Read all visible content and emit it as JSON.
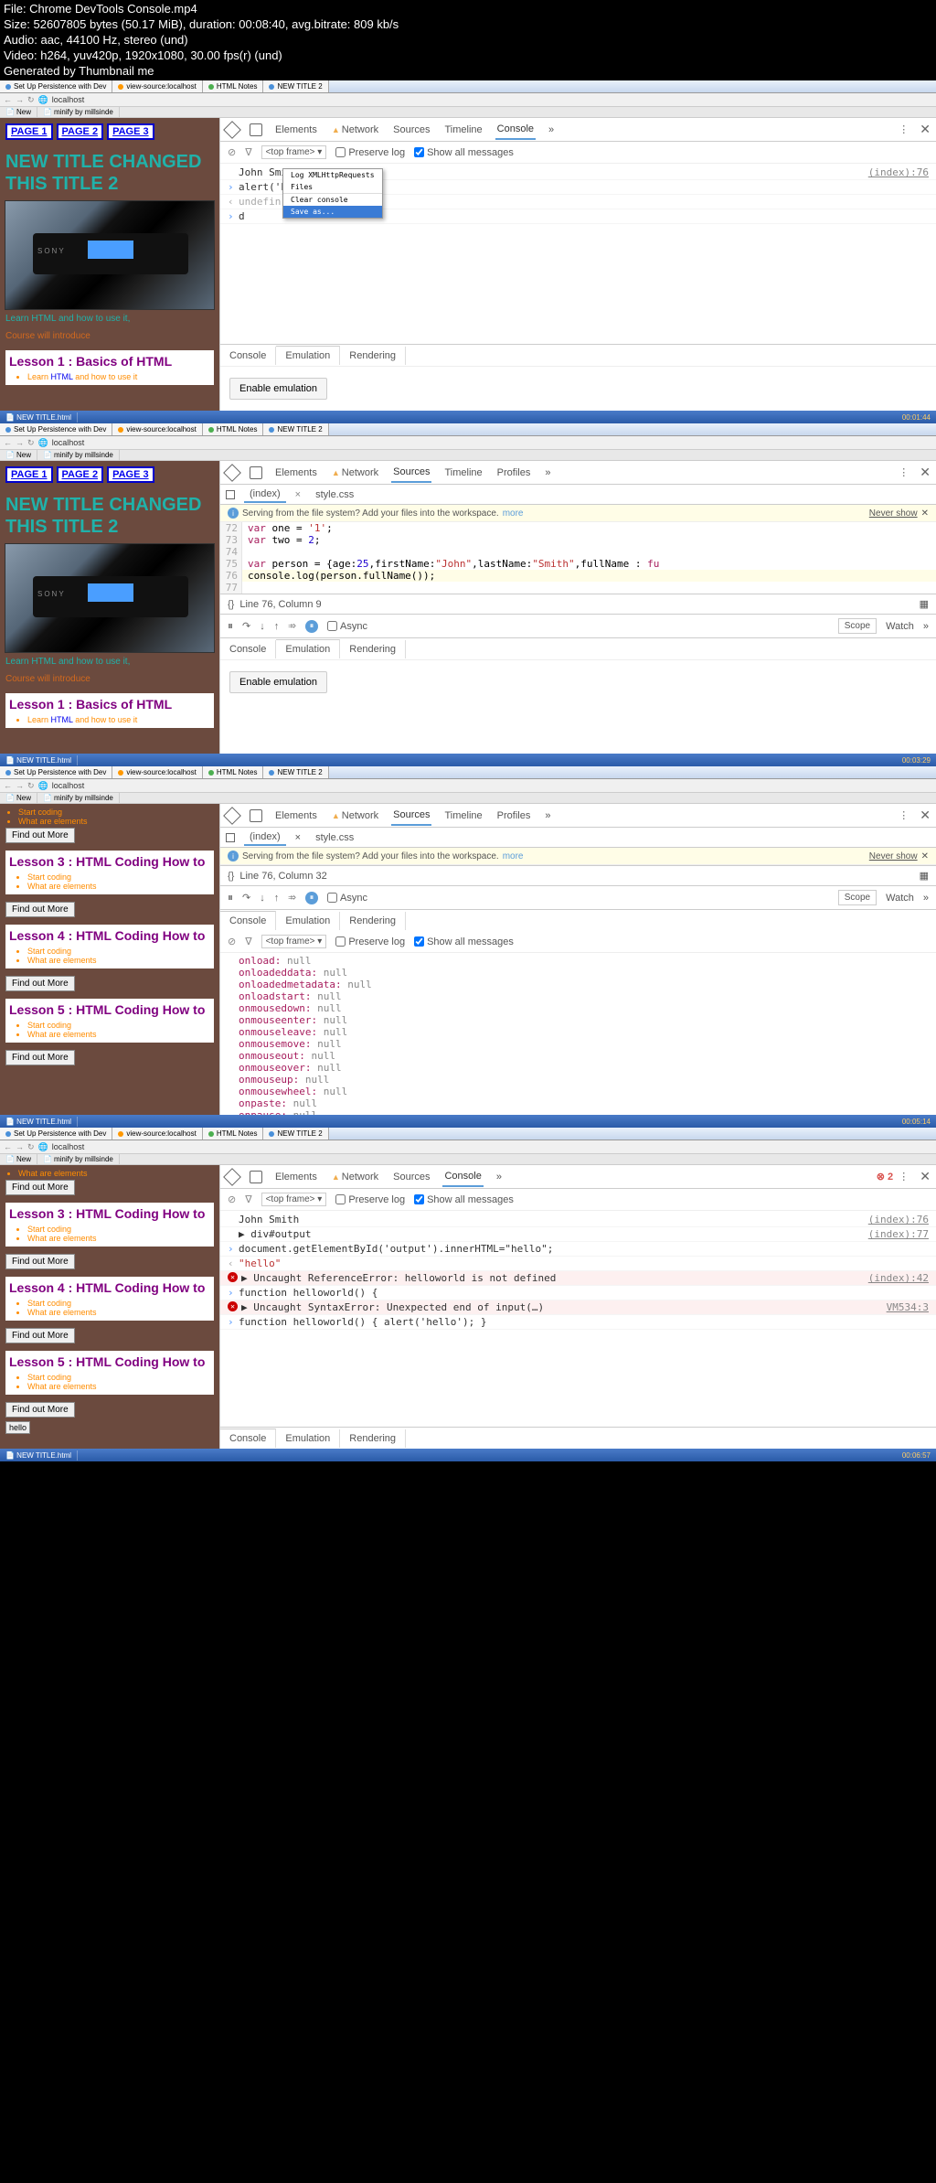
{
  "meta": {
    "file": "File: Chrome DevTools Console.mp4",
    "size": "Size: 52607805 bytes (50.17 MiB), duration: 00:08:40, avg.bitrate: 809 kb/s",
    "audio": "Audio: aac, 44100 Hz, stereo (und)",
    "video": "Video: h264, yuv420p, 1920x1080, 30.00 fps(r) (und)",
    "gen": "Generated by Thumbnail me"
  },
  "browser": {
    "tabs": [
      "Set Up Persistence with Dev",
      "view-source:localhost",
      "HTML Notes",
      "NEW TITLE 2"
    ],
    "url": "localhost",
    "minitab1": "New",
    "minitab2": "minify by millsinde"
  },
  "page": {
    "links": [
      "PAGE 1",
      "PAGE 2",
      "PAGE 3"
    ],
    "title": "NEW TITLE CHANGED THIS TITLE 2",
    "learn": "Learn HTML and how to use it,",
    "intro": "Course will introduce",
    "lesson1": "Lesson 1 : Basics of HTML",
    "lesson1_item": "Learn HTML and how to use it",
    "lesson3": "Lesson 3 : HTML Coding How to",
    "lesson4": "Lesson 4 : HTML Coding How to",
    "lesson5": "Lesson 5 : HTML Coding How to",
    "li1": "Start coding",
    "li2": "What are elements",
    "btn_more": "Find out More",
    "sony": "SONY",
    "hello": "hello"
  },
  "dt": {
    "tabs": {
      "elements": "Elements",
      "network": "Network",
      "sources": "Sources",
      "timeline": "Timeline",
      "console": "Console",
      "profiles": "Profiles",
      "more": "»"
    },
    "topframe": "<top frame>",
    "preserve": "Preserve log",
    "showall": "Show all messages",
    "enable_emul": "Enable emulation",
    "sub": {
      "console": "Console",
      "emulation": "Emulation",
      "rendering": "Rendering"
    },
    "async": "Async",
    "scope": "Scope",
    "watch": "Watch"
  },
  "shot1": {
    "con": {
      "l1": "John Smith",
      "r1": "(index):76",
      "l2": "alert('h",
      "l3": "undefin",
      "l4": "d"
    },
    "menu": {
      "m1": "Log XMLHttpRequests",
      "m2": "Files",
      "m3": "Clear console",
      "m4": "Save as..."
    },
    "time": "00:01:44"
  },
  "shot2": {
    "src_tabs": {
      "index": "(index)",
      "style": "style.css"
    },
    "info": "Serving from the file system? Add your files into the workspace.",
    "more": "more",
    "never": "Never show",
    "code": {
      "72": "var one = '1';",
      "73": "var two = 2;",
      "74": "",
      "75": "var person = {age:25,firstName:\"John\",lastName:\"Smith\",fullName : fun",
      "76": "console.log(person.fullName());",
      "77": ""
    },
    "status": "Line 76, Column 9",
    "time": "00:03:29"
  },
  "shot3": {
    "status": "Line 76, Column 32",
    "props": [
      "onload: null",
      "onloadeddata: null",
      "onloadedmetadata: null",
      "onloadstart: null",
      "onmousedown: null",
      "onmouseenter: null",
      "onmouseleave: null",
      "onmousemove: null",
      "onmouseout: null",
      "onmouseover: null",
      "onmouseup: null",
      "onmousewheel: null",
      "onpaste: null",
      "onpause: null"
    ],
    "time": "00:05:14"
  },
  "shot4": {
    "err_count": "2",
    "con": {
      "l1": "John Smith",
      "r1": "(index):76",
      "l2": "▶ div#output",
      "r2": "(index):77",
      "l3": "document.getElementById('output').innerHTML=\"hello\";",
      "l4": "\"hello\"",
      "l5": "▶ Uncaught ReferenceError: helloworld is not defined",
      "r5": "(index):42",
      "l6": "function helloworld() {",
      "l7": "▶ Uncaught SyntaxError: Unexpected end of input(…)",
      "r7": "VM534:3",
      "l8": "function helloworld() { alert('hello'); }"
    },
    "time": "00:06:57"
  },
  "chart_data": null
}
